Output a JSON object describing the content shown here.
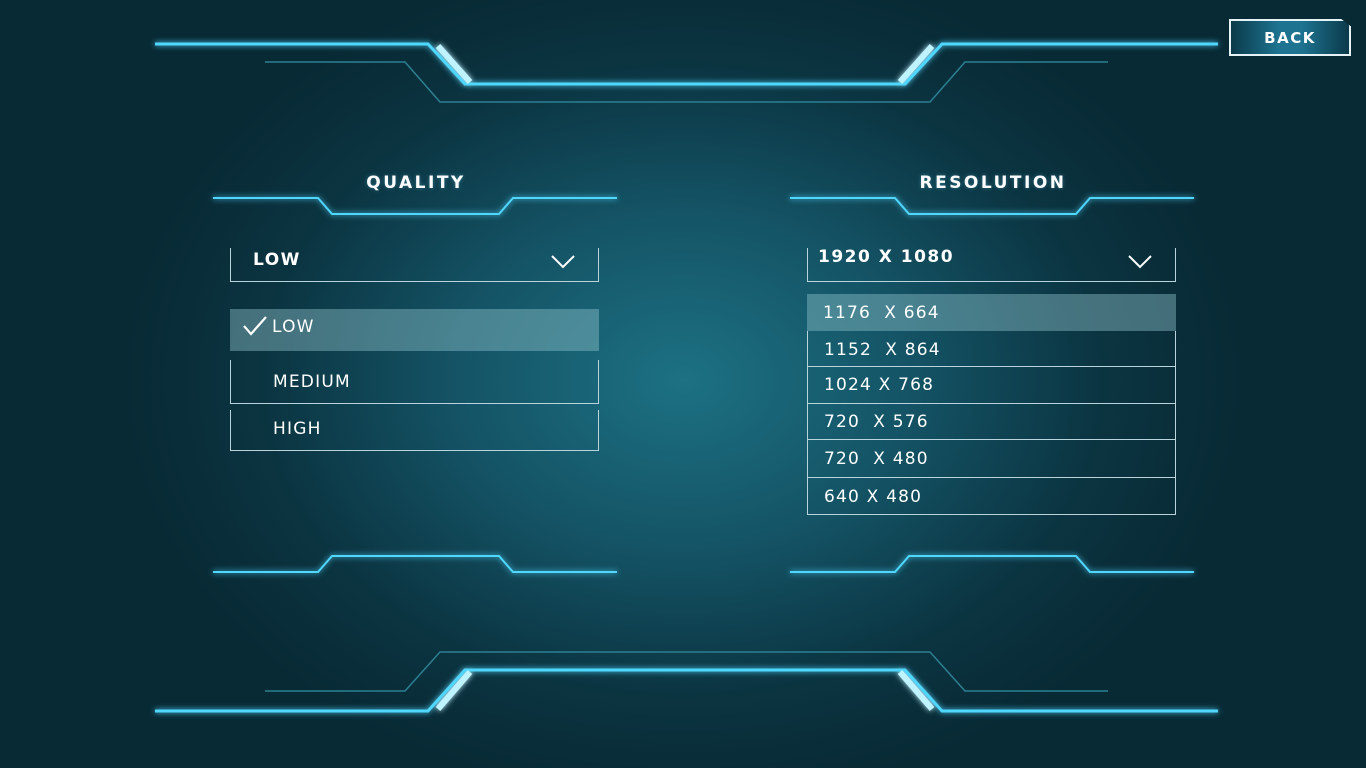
{
  "header": {
    "back_label": "BACK"
  },
  "quality": {
    "title": "QUALITY",
    "selected": "LOW",
    "options": [
      {
        "label": "LOW",
        "checked": true
      },
      {
        "label": "MEDIUM",
        "checked": false
      },
      {
        "label": "HIGH",
        "checked": false
      }
    ]
  },
  "resolution": {
    "title": "RESOLUTION",
    "selected": "1920 X 1080",
    "options": [
      {
        "label": "1176  X 664",
        "highlighted": true
      },
      {
        "label": "1152  X 864",
        "highlighted": false
      },
      {
        "label": "1024 X 768",
        "highlighted": false
      },
      {
        "label": "720  X 576",
        "highlighted": false
      },
      {
        "label": "720  X 480",
        "highlighted": false
      },
      {
        "label": "640 X 480",
        "highlighted": false
      }
    ]
  },
  "icons": {
    "dropdown": "chevron-down-icon",
    "selected": "checkmark-icon"
  },
  "colors": {
    "glow": "#4fd7ff",
    "line_dim": "#2c7f92",
    "outline": "#b9d4dc",
    "selected_fill": "#6aa0ab"
  }
}
